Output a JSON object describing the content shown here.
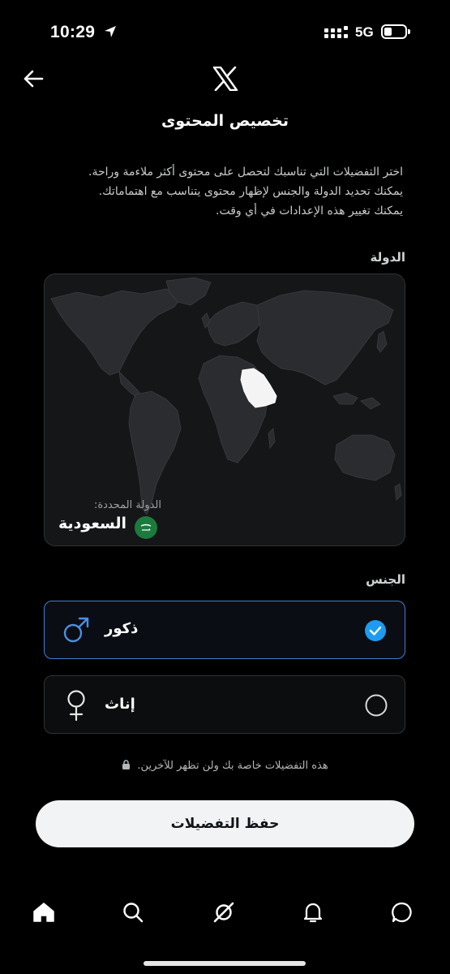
{
  "status_bar": {
    "time": "10:29",
    "network": "5G"
  },
  "header": {
    "title": "تخصيص المحتوى"
  },
  "description": [
    "اختر التفضيلات التي تناسبك لتحصل على محتوى أكثر ملاءمة وراحة.",
    "يمكنك تحديد الدولة والجنس لإظهار محتوى يتناسب مع اهتماماتك.",
    "يمكنك تغيير هذه الإعدادات في أي وقت."
  ],
  "country_section": {
    "label": "الدولة",
    "selected_label": "الدولة المحددة:",
    "selected_country": "السعودية"
  },
  "gender_section": {
    "label": "الجنس",
    "options": [
      {
        "label": "ذكور",
        "icon": "male-icon",
        "selected": true
      },
      {
        "label": "إناث",
        "icon": "female-icon",
        "selected": false
      }
    ]
  },
  "privacy_note": "هذه التفضيلات خاصة بك ولن تظهر للآخرين.",
  "save_button": "حفظ التفضيلات",
  "bottom_nav": [
    "home-icon",
    "search-icon",
    "grok-icon",
    "notifications-icon",
    "messages-icon"
  ],
  "colors": {
    "accent": "#1d9bf0",
    "selected_border": "#3f7fd1",
    "flag_green": "#1c7a3d"
  }
}
